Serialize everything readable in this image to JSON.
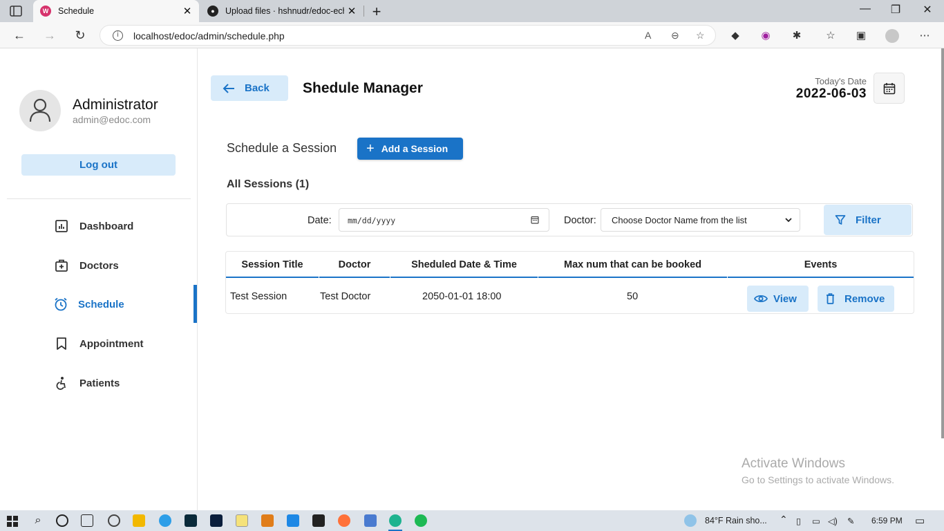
{
  "browser": {
    "tabs": [
      {
        "title": "Schedule",
        "active": true
      },
      {
        "title": "Upload files · hshnudr/edoc-echa",
        "active": false
      }
    ],
    "url": "localhost/edoc/admin/schedule.php",
    "window_controls": {
      "minimize": "—",
      "restore": "❐",
      "close": "✕"
    }
  },
  "sidebar": {
    "name": "Administrator",
    "email": "admin@edoc.com",
    "logout_label": "Log out",
    "menu": [
      {
        "label": "Dashboard",
        "icon": "dashboard-icon"
      },
      {
        "label": "Doctors",
        "icon": "doctors-icon"
      },
      {
        "label": "Schedule",
        "icon": "clock-icon",
        "active": true
      },
      {
        "label": "Appointment",
        "icon": "bookmark-icon"
      },
      {
        "label": "Patients",
        "icon": "patients-icon"
      }
    ]
  },
  "header": {
    "back_label": "Back",
    "title": "Shedule Manager",
    "today_label": "Today's Date",
    "today_value": "2022-06-03"
  },
  "schedule": {
    "section_title": "Schedule a Session",
    "add_label": "Add a Session",
    "all_sessions": "All Sessions (1)"
  },
  "filter": {
    "date_label": "Date:",
    "date_placeholder": "mm/dd/yyyy",
    "doctor_label": "Doctor:",
    "doctor_selected": "Choose Doctor Name from the list",
    "filter_label": "Filter"
  },
  "table": {
    "headers": [
      "Session Title",
      "Doctor",
      "Sheduled Date & Time",
      "Max num that can be booked",
      "Events"
    ],
    "rows": [
      {
        "title": "Test Session",
        "doctor": "Test Doctor",
        "datetime": "2050-01-01 18:00",
        "max": "50",
        "view_label": "View",
        "remove_label": "Remove"
      }
    ]
  },
  "watermark": {
    "line1": "Activate Windows",
    "line2": "Go to Settings to activate Windows."
  },
  "taskbar": {
    "weather": "84°F  Rain sho...",
    "time": "6:59 PM"
  },
  "colors": {
    "accent": "#1a73c7",
    "accent_light": "#d8ebfa"
  }
}
